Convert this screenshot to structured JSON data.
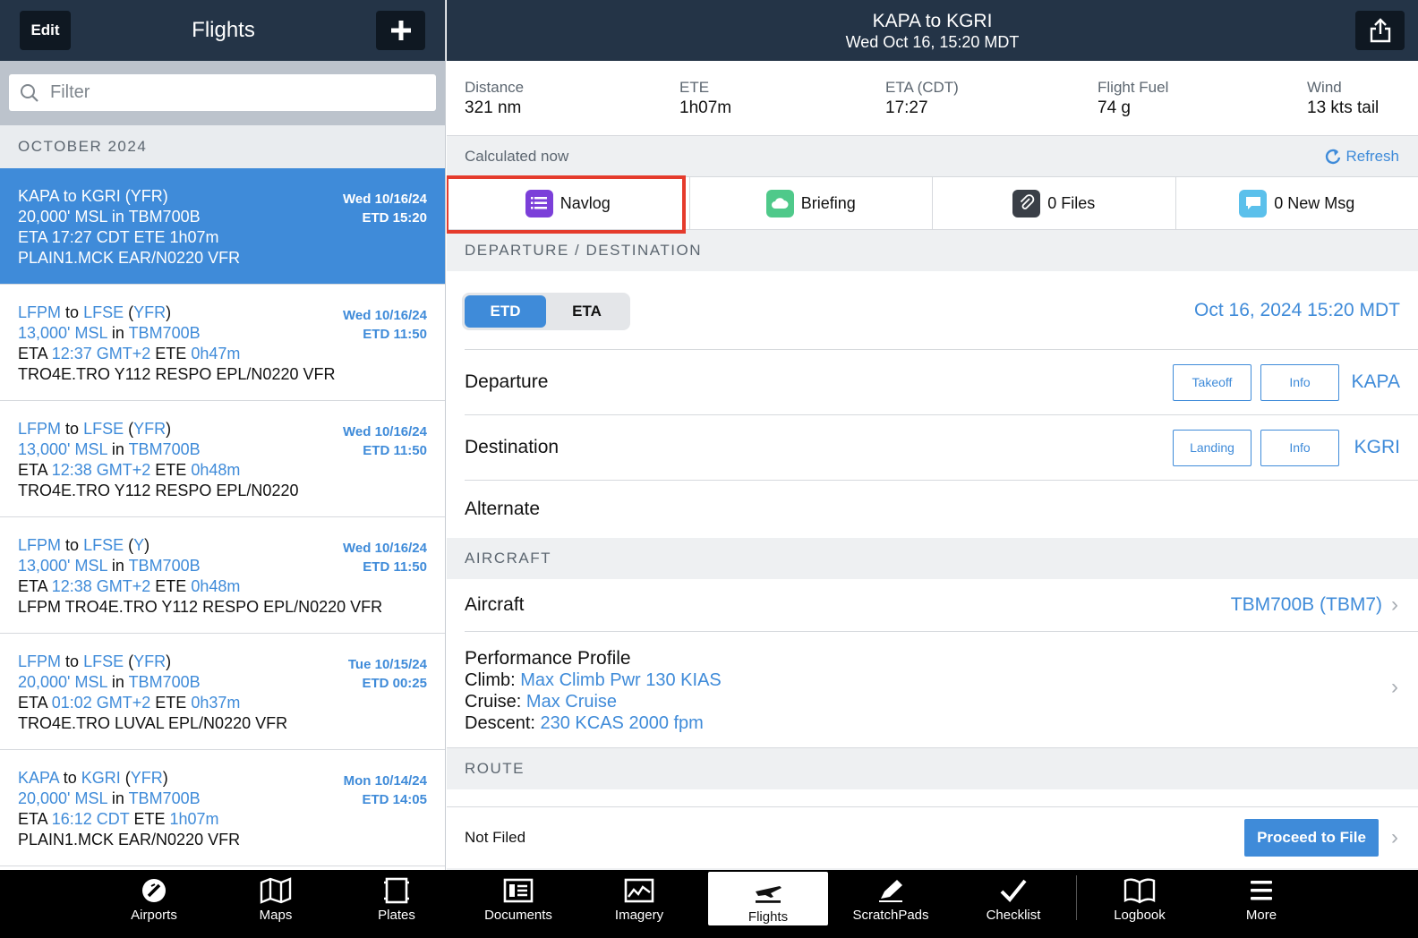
{
  "left": {
    "edit_label": "Edit",
    "title": "Flights",
    "filter_placeholder": "Filter",
    "month": "OCTOBER 2024",
    "flights": [
      {
        "from": "KAPA",
        "to": "KGRI",
        "rules": "YFR",
        "alt": "20,000' MSL",
        "aircraft": "TBM700B",
        "eta": "17:27 CDT",
        "ete": "1h07m",
        "route": "PLAIN1.MCK EAR/N0220 VFR",
        "day": "Wed 10/16/24",
        "etd": "ETD 15:20"
      },
      {
        "from": "LFPM",
        "to": "LFSE",
        "rules": "YFR",
        "alt": "13,000' MSL",
        "aircraft": "TBM700B",
        "eta": "12:37 GMT+2",
        "ete": "0h47m",
        "route": "TRO4E.TRO Y112 RESPO EPL/N0220 VFR",
        "day": "Wed 10/16/24",
        "etd": "ETD 11:50"
      },
      {
        "from": "LFPM",
        "to": "LFSE",
        "rules": "YFR",
        "alt": "13,000' MSL",
        "aircraft": "TBM700B",
        "eta": "12:38 GMT+2",
        "ete": "0h48m",
        "route": "TRO4E.TRO Y112 RESPO EPL/N0220",
        "day": "Wed 10/16/24",
        "etd": "ETD 11:50"
      },
      {
        "from": "LFPM",
        "to": "LFSE",
        "rules": "Y",
        "alt": "13,000' MSL",
        "aircraft": "TBM700B",
        "eta": "12:38 GMT+2",
        "ete": "0h48m",
        "route": "LFPM TRO4E.TRO Y112 RESPO EPL/N0220 VFR",
        "day": "Wed 10/16/24",
        "etd": "ETD 11:50"
      },
      {
        "from": "LFPM",
        "to": "LFSE",
        "rules": "YFR",
        "alt": "20,000' MSL",
        "aircraft": "TBM700B",
        "eta": "01:02 GMT+2",
        "ete": "0h37m",
        "route": "TRO4E.TRO LUVAL EPL/N0220 VFR",
        "day": "Tue 10/15/24",
        "etd": "ETD 00:25"
      },
      {
        "from": "KAPA",
        "to": "KGRI",
        "rules": "YFR",
        "alt": "20,000' MSL",
        "aircraft": "TBM700B",
        "eta": "16:12 CDT",
        "ete": "1h07m",
        "route": "PLAIN1.MCK EAR/N0220 VFR",
        "day": "Mon 10/14/24",
        "etd": "ETD 14:05"
      }
    ],
    "words": {
      "to": "to",
      "in": "in",
      "eta": "ETA",
      "ete": "ETE"
    }
  },
  "header": {
    "title": "KAPA to KGRI",
    "subtitle": "Wed Oct 16, 15:20 MDT"
  },
  "stats": [
    {
      "label": "Distance",
      "value": "321 nm"
    },
    {
      "label": "ETE",
      "value": "1h07m"
    },
    {
      "label": "ETA (CDT)",
      "value": "17:27"
    },
    {
      "label": "Flight Fuel",
      "value": "74 g"
    },
    {
      "label": "Wind",
      "value": "13 kts tail"
    }
  ],
  "calc": {
    "status": "Calculated now",
    "refresh": "Refresh"
  },
  "tabs": [
    {
      "label": "Navlog",
      "icon": "navlog-icon",
      "color": "#7b3fd9"
    },
    {
      "label": "Briefing",
      "icon": "cloud-icon",
      "color": "#4fc98a"
    },
    {
      "label": "0 Files",
      "icon": "paperclip-icon",
      "color": "#3a3f47"
    },
    {
      "label": "0 New Msg",
      "icon": "message-icon",
      "color": "#5bc0eb"
    }
  ],
  "depdest": {
    "section": "DEPARTURE / DESTINATION",
    "etd_tab": "ETD",
    "eta_tab": "ETA",
    "time": "Oct 16, 2024 15:20 MDT",
    "departure_label": "Departure",
    "takeoff_btn": "Takeoff",
    "info_btn": "Info",
    "departure": "KAPA",
    "destination_label": "Destination",
    "landing_btn": "Landing",
    "destination": "KGRI",
    "alternate_label": "Alternate"
  },
  "aircraft": {
    "section": "AIRCRAFT",
    "label": "Aircraft",
    "value": "TBM700B (TBM7)",
    "perf_label": "Performance Profile",
    "climb_label": "Climb:",
    "climb": "Max Climb Pwr 130 KIAS",
    "cruise_label": "Cruise:",
    "cruise": "Max Cruise",
    "descent_label": "Descent:",
    "descent": "230 KCAS 2000 fpm"
  },
  "route": {
    "section": "ROUTE",
    "filed_status": "Not Filed",
    "proceed": "Proceed to File"
  },
  "tabbar": [
    {
      "label": "Airports",
      "icon": "airports-icon"
    },
    {
      "label": "Maps",
      "icon": "maps-icon"
    },
    {
      "label": "Plates",
      "icon": "plates-icon"
    },
    {
      "label": "Documents",
      "icon": "documents-icon"
    },
    {
      "label": "Imagery",
      "icon": "imagery-icon"
    },
    {
      "label": "Flights",
      "icon": "flights-icon"
    },
    {
      "label": "ScratchPads",
      "icon": "scratchpads-icon"
    },
    {
      "label": "Checklist",
      "icon": "checklist-icon"
    },
    {
      "label": "Logbook",
      "icon": "logbook-icon"
    },
    {
      "label": "More",
      "icon": "more-icon"
    }
  ],
  "colors": {
    "accent": "#3f8bd9",
    "header": "#243447",
    "highlight": "#e53b2c"
  }
}
